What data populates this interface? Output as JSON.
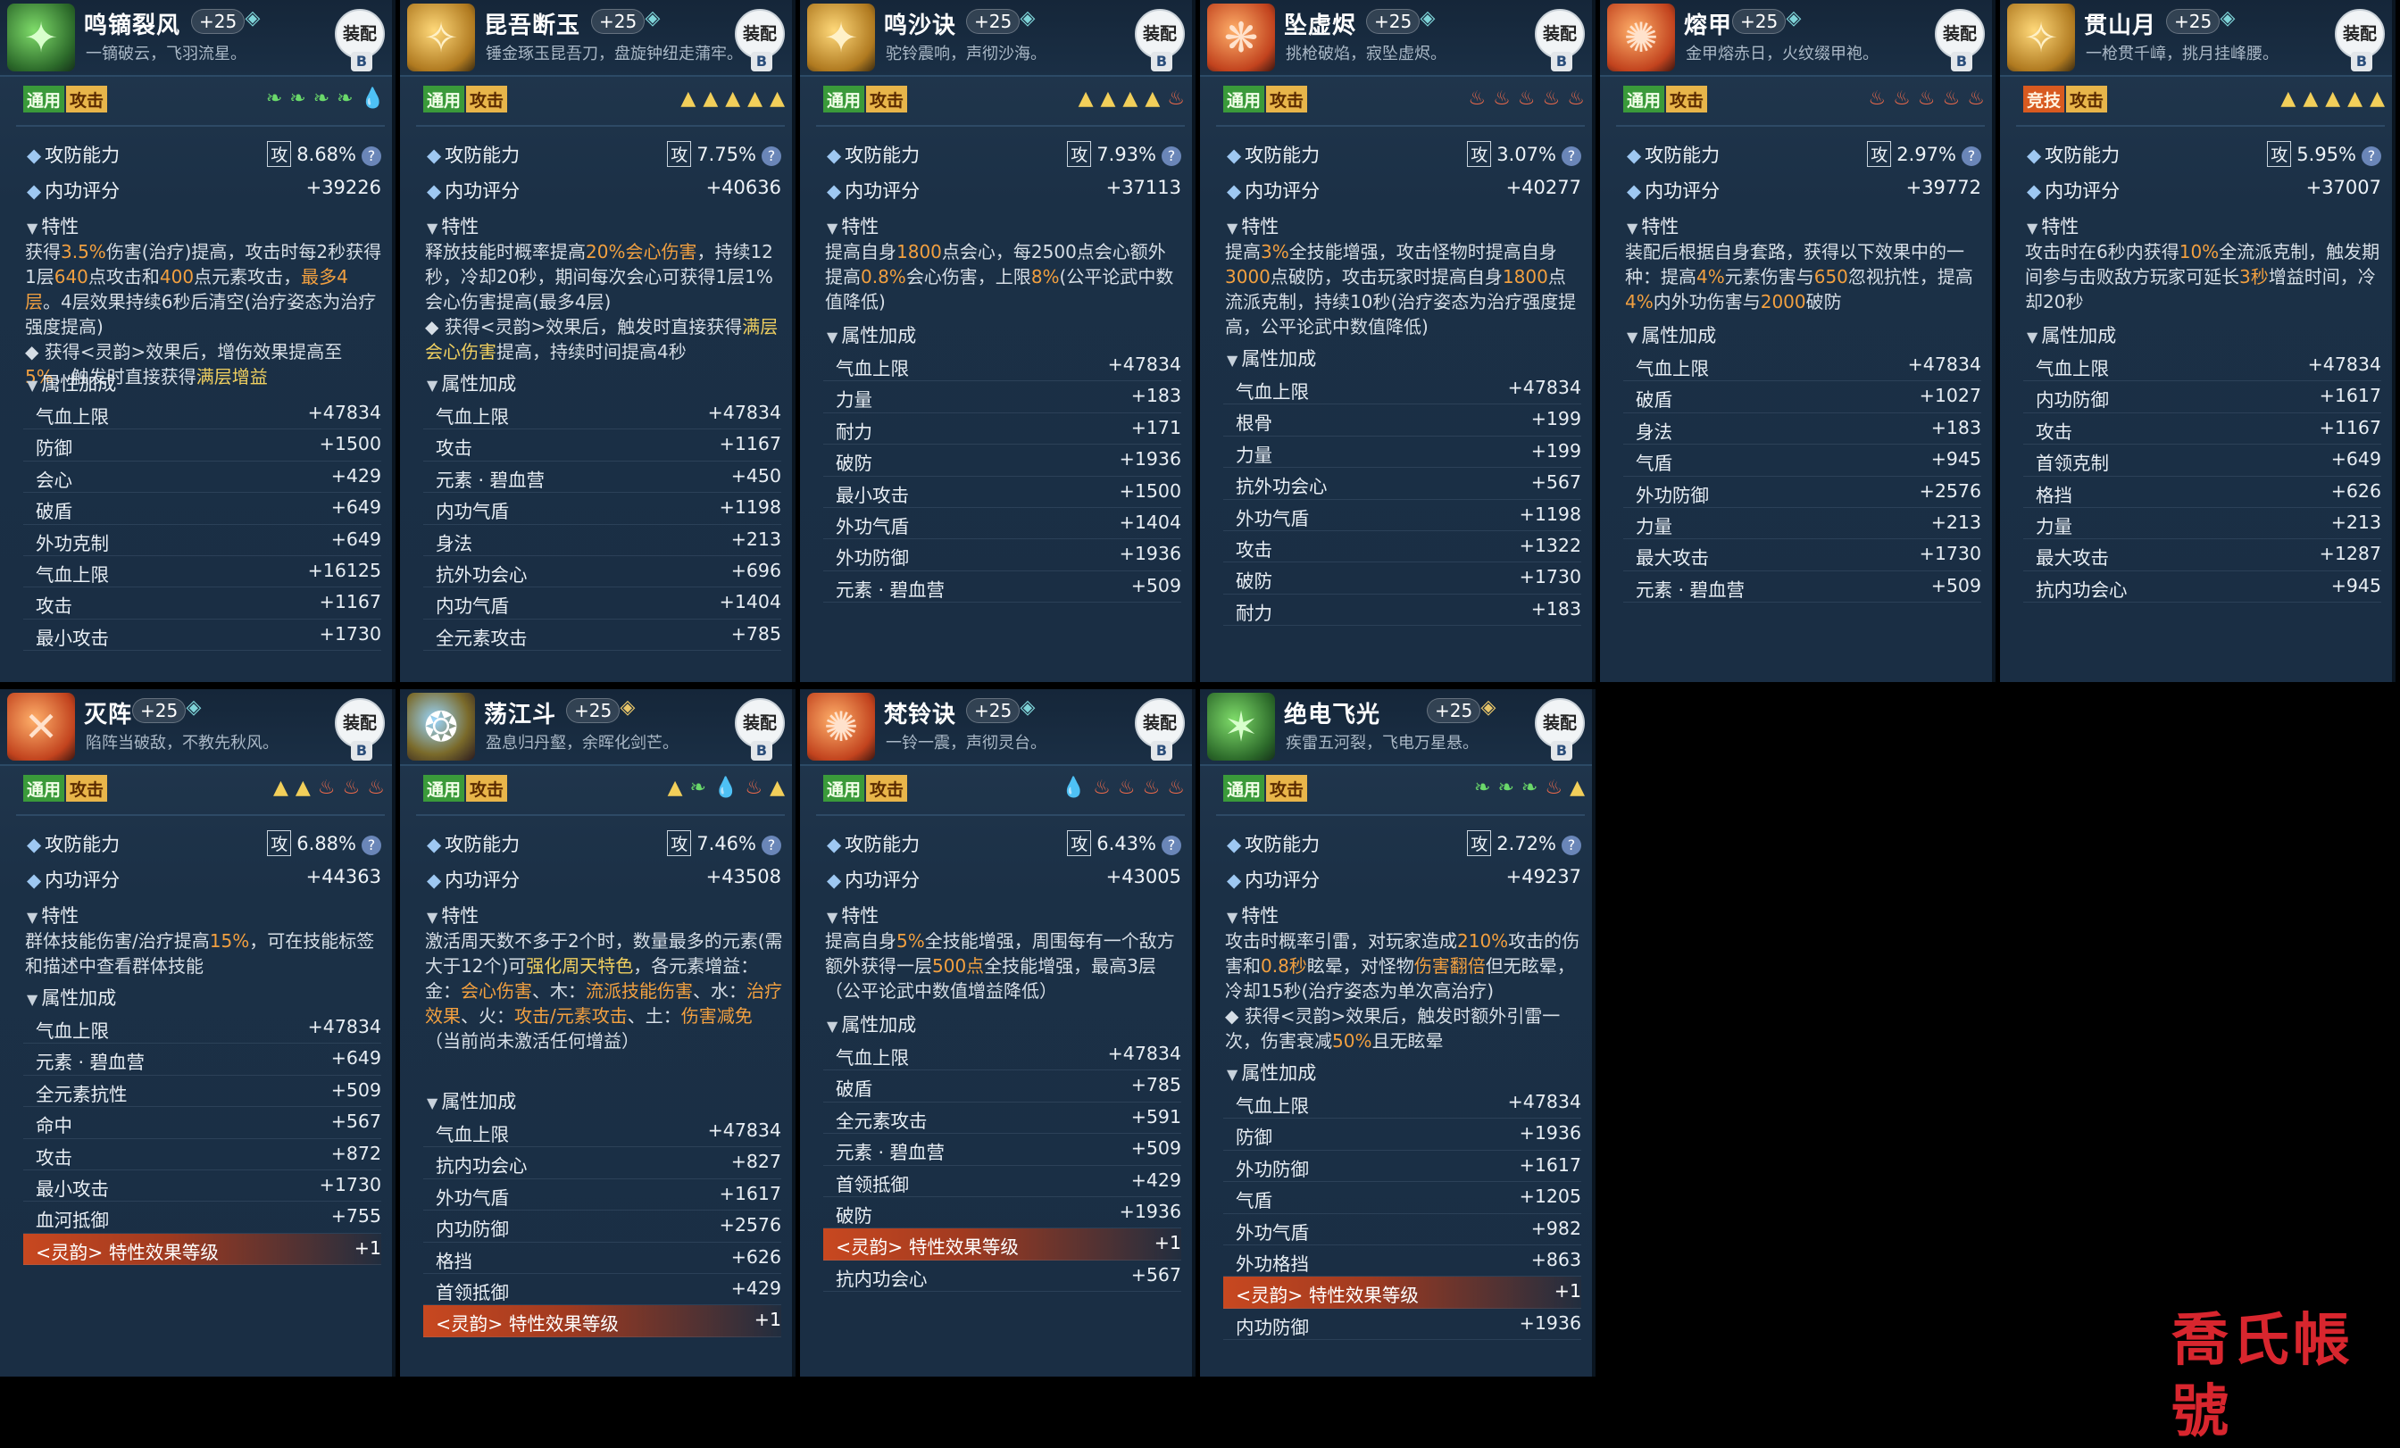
{
  "common": {
    "equip_label": "装配",
    "equip_sub": "B",
    "tag_common": "通用",
    "tag_attack": "攻击",
    "tag_pvp": "竞技",
    "atkdef_label": "攻防能力",
    "atk_badge": "攻",
    "q_mark": "?",
    "inner_label": "内功评分",
    "trait_label": "特性",
    "attr_label": "属性加成"
  },
  "watermark": "喬氏帳號",
  "cards": [
    {
      "title": "鸣镝裂风",
      "level": "+25",
      "subtitle": "一镝破云，飞羽流星。",
      "atk_pct": "8.68%",
      "inner": "+39226",
      "trait_html": "获得<span class='hl-o'>3.5%</span>伤害(治疗)提高，攻击时每2秒获得1层<span class='hl-o'>640</span>点攻击和<span class='hl-o'>400</span>点元素攻击，<span class='hl-o'>最多4层</span>。4层效果持续6秒后清空(治疗姿态为治疗强度提高)<br>◆ 获得&lt;灵韵&gt;效果后，增伤效果提高至<span class='hl-o'>5%</span>，触发时直接获得<span class='hl-y'>满层增益</span>",
      "attrs": [
        {
          "n": "气血上限",
          "v": "+47834"
        },
        {
          "n": "防御",
          "v": "+1500"
        },
        {
          "n": "会心",
          "v": "+429"
        },
        {
          "n": "破盾",
          "v": "+649"
        },
        {
          "n": "外功克制",
          "v": "+649"
        },
        {
          "n": "气血上限",
          "v": "+16125"
        },
        {
          "n": "攻击",
          "v": "+1167"
        },
        {
          "n": "最小攻击",
          "v": "+1730"
        }
      ]
    },
    {
      "title": "昆吾断玉",
      "level": "+25",
      "subtitle": "锤金琢玉昆吾刀，盘旋钟纽走蒲牢。",
      "atk_pct": "7.75%",
      "inner": "+40636",
      "trait_html": "释放技能时概率提高<span class='hl-o'>20%会心伤害</span>，持续12秒，冷却20秒，期间每次会心可获得1层1%会心伤害提高(最多4层)<br>◆ 获得&lt;灵韵&gt;效果后，触发时直接获得<span class='hl-y'>满层会心伤害</span>提高，持续时间提高4秒",
      "attrs": [
        {
          "n": "气血上限",
          "v": "+47834"
        },
        {
          "n": "攻击",
          "v": "+1167"
        },
        {
          "n": "元素 · 碧血营",
          "v": "+450"
        },
        {
          "n": "内功气盾",
          "v": "+1198"
        },
        {
          "n": "身法",
          "v": "+213"
        },
        {
          "n": "抗外功会心",
          "v": "+696"
        },
        {
          "n": "内功气盾",
          "v": "+1404"
        },
        {
          "n": "全元素攻击",
          "v": "+785"
        }
      ]
    },
    {
      "title": "鸣沙诀",
      "level": "+25",
      "subtitle": "驼铃震响，声彻沙海。",
      "atk_pct": "7.93%",
      "inner": "+37113",
      "trait_html": "提高自身<span class='hl-o'>1800</span>点会心，每2500点会心额外提高<span class='hl-o'>0.8%</span>会心伤害，上限<span class='hl-o'>8%</span>(公平论武中数值降低)",
      "attrs": [
        {
          "n": "气血上限",
          "v": "+47834"
        },
        {
          "n": "力量",
          "v": "+183"
        },
        {
          "n": "耐力",
          "v": "+171"
        },
        {
          "n": "破防",
          "v": "+1936"
        },
        {
          "n": "最小攻击",
          "v": "+1500"
        },
        {
          "n": "外功气盾",
          "v": "+1404"
        },
        {
          "n": "外功防御",
          "v": "+1936"
        },
        {
          "n": "元素 · 碧血营",
          "v": "+509"
        }
      ]
    },
    {
      "title": "坠虚烬",
      "level": "+25",
      "subtitle": "挑枪破焰，寂坠虚烬。",
      "atk_pct": "3.07%",
      "inner": "+40277",
      "trait_html": "提高<span class='hl-o'>3%</span>全技能增强，攻击怪物时提高自身<span class='hl-o'>3000</span>点破防，攻击玩家时提高自身<span class='hl-o'>1800</span>点流派克制，持续10秒(治疗姿态为治疗强度提高，公平论武中数值降低)",
      "attrs": [
        {
          "n": "气血上限",
          "v": "+47834"
        },
        {
          "n": "根骨",
          "v": "+199"
        },
        {
          "n": "力量",
          "v": "+199"
        },
        {
          "n": "抗外功会心",
          "v": "+567"
        },
        {
          "n": "外功气盾",
          "v": "+1198"
        },
        {
          "n": "攻击",
          "v": "+1322"
        },
        {
          "n": "破防",
          "v": "+1730"
        },
        {
          "n": "耐力",
          "v": "+183"
        }
      ]
    },
    {
      "title": "熔甲",
      "level": "+25",
      "subtitle": "金甲熔赤日，火纹缀甲袍。",
      "atk_pct": "2.97%",
      "inner": "+39772",
      "trait_html": "装配后根据自身套路，获得以下效果中的一种：提高<span class='hl-o'>4%</span>元素伤害与<span class='hl-o'>650</span>忽视抗性，提高<span class='hl-o'>4%</span>内外功伤害与<span class='hl-o'>2000</span>破防",
      "attrs": [
        {
          "n": "气血上限",
          "v": "+47834"
        },
        {
          "n": "破盾",
          "v": "+1027"
        },
        {
          "n": "身法",
          "v": "+183"
        },
        {
          "n": "气盾",
          "v": "+945"
        },
        {
          "n": "外功防御",
          "v": "+2576"
        },
        {
          "n": "力量",
          "v": "+213"
        },
        {
          "n": "最大攻击",
          "v": "+1730"
        },
        {
          "n": "元素 · 碧血营",
          "v": "+509"
        }
      ]
    },
    {
      "title": "贯山月",
      "level": "+25",
      "subtitle": "一枪贯千嶂，挑月挂峰腰。",
      "atk_pct": "5.95%",
      "inner": "+37007",
      "trait_html": "攻击时在6秒内获得<span class='hl-o'>10%</span>全流派克制，触发期间参与击败敌方玩家可延长<span class='hl-o'>3秒</span>增益时间，冷却20秒",
      "attrs": [
        {
          "n": "气血上限",
          "v": "+47834"
        },
        {
          "n": "内功防御",
          "v": "+1617"
        },
        {
          "n": "攻击",
          "v": "+1167"
        },
        {
          "n": "首领克制",
          "v": "+649"
        },
        {
          "n": "格挡",
          "v": "+626"
        },
        {
          "n": "力量",
          "v": "+213"
        },
        {
          "n": "最大攻击",
          "v": "+1287"
        },
        {
          "n": "抗内功会心",
          "v": "+945"
        }
      ]
    },
    {
      "title": "灭阵",
      "level": "+25",
      "subtitle": "陷阵当破敌，不教先秋风。",
      "atk_pct": "6.88%",
      "inner": "+44363",
      "trait_html": "群体技能伤害/治疗提高<span class='hl-o'>15%</span>，可在技能标签和描述中查看群体技能",
      "attrs": [
        {
          "n": "气血上限",
          "v": "+47834"
        },
        {
          "n": "元素 · 碧血营",
          "v": "+649"
        },
        {
          "n": "全元素抗性",
          "v": "+509"
        },
        {
          "n": "命中",
          "v": "+567"
        },
        {
          "n": "攻击",
          "v": "+872"
        },
        {
          "n": "最小攻击",
          "v": "+1730"
        },
        {
          "n": "血河抵御",
          "v": "+755"
        },
        {
          "n": "<灵韵> 特性效果等级",
          "v": "+1",
          "ling": true
        }
      ]
    },
    {
      "title": "荡江斗",
      "level": "+25",
      "subtitle": "盈息归丹壑，余晖化剑芒。",
      "atk_pct": "7.46%",
      "inner": "+43508",
      "trait_html": "激活周天数不多于2个时，数量最多的元素(需大于12个)可<span class='hl-y'>强化周天特色</span>，各元素增益：<br>金：<span class='hl-o'>会心伤害</span>、木：<span class='hl-o'>流派技能伤害</span>、水：<span class='hl-o'>治疗效果</span>、火：<span class='hl-o'>攻击/元素攻击</span>、土：<span class='hl-o'>伤害减免</span><br>（当前尚未激活任何增益）",
      "attrs": [
        {
          "n": "气血上限",
          "v": "+47834"
        },
        {
          "n": "抗内功会心",
          "v": "+827"
        },
        {
          "n": "外功气盾",
          "v": "+1617"
        },
        {
          "n": "内功防御",
          "v": "+2576"
        },
        {
          "n": "格挡",
          "v": "+626"
        },
        {
          "n": "首领抵御",
          "v": "+429"
        },
        {
          "n": "<灵韵> 特性效果等级",
          "v": "+1",
          "ling": true
        }
      ]
    },
    {
      "title": "梵铃诀",
      "level": "+25",
      "subtitle": "一铃一震，声彻灵台。",
      "atk_pct": "6.43%",
      "inner": "+43005",
      "trait_html": "提高自身<span class='hl-o'>5%</span>全技能增强，周围每有一个敌方额外获得一层<span class='hl-o'>500点</span>全技能增强，最高3层（公平论武中数值增益降低）",
      "attrs": [
        {
          "n": "气血上限",
          "v": "+47834"
        },
        {
          "n": "破盾",
          "v": "+785"
        },
        {
          "n": "全元素攻击",
          "v": "+591"
        },
        {
          "n": "元素 · 碧血营",
          "v": "+509"
        },
        {
          "n": "首领抵御",
          "v": "+429"
        },
        {
          "n": "破防",
          "v": "+1936"
        },
        {
          "n": "<灵韵> 特性效果等级",
          "v": "+1",
          "ling": true
        },
        {
          "n": "抗内功会心",
          "v": "+567"
        }
      ]
    },
    {
      "title": "绝电飞光",
      "level": "+25",
      "subtitle": "疾雷五河裂，飞电万星悬。",
      "atk_pct": "2.72%",
      "inner": "+49237",
      "trait_html": "攻击时概率引雷，对玩家造成<span class='hl-o'>210%</span>攻击的伤害和<span class='hl-o'>0.8秒</span>眩晕，对怪物<span class='hl-o'>伤害翻倍</span>但无眩晕，冷却15秒(治疗姿态为单次高治疗)<br>◆ 获得&lt;灵韵&gt;效果后，触发时额外引雷一次，伤害衰减<span class='hl-o'>50%</span>且无眩晕",
      "attrs": [
        {
          "n": "气血上限",
          "v": "+47834"
        },
        {
          "n": "防御",
          "v": "+1936"
        },
        {
          "n": "外功防御",
          "v": "+1617"
        },
        {
          "n": "气盾",
          "v": "+1205"
        },
        {
          "n": "外功气盾",
          "v": "+982"
        },
        {
          "n": "外功格挡",
          "v": "+863"
        },
        {
          "n": "<灵韵> 特性效果等级",
          "v": "+1",
          "ling": true
        },
        {
          "n": "内功防御",
          "v": "+1936"
        }
      ]
    }
  ]
}
